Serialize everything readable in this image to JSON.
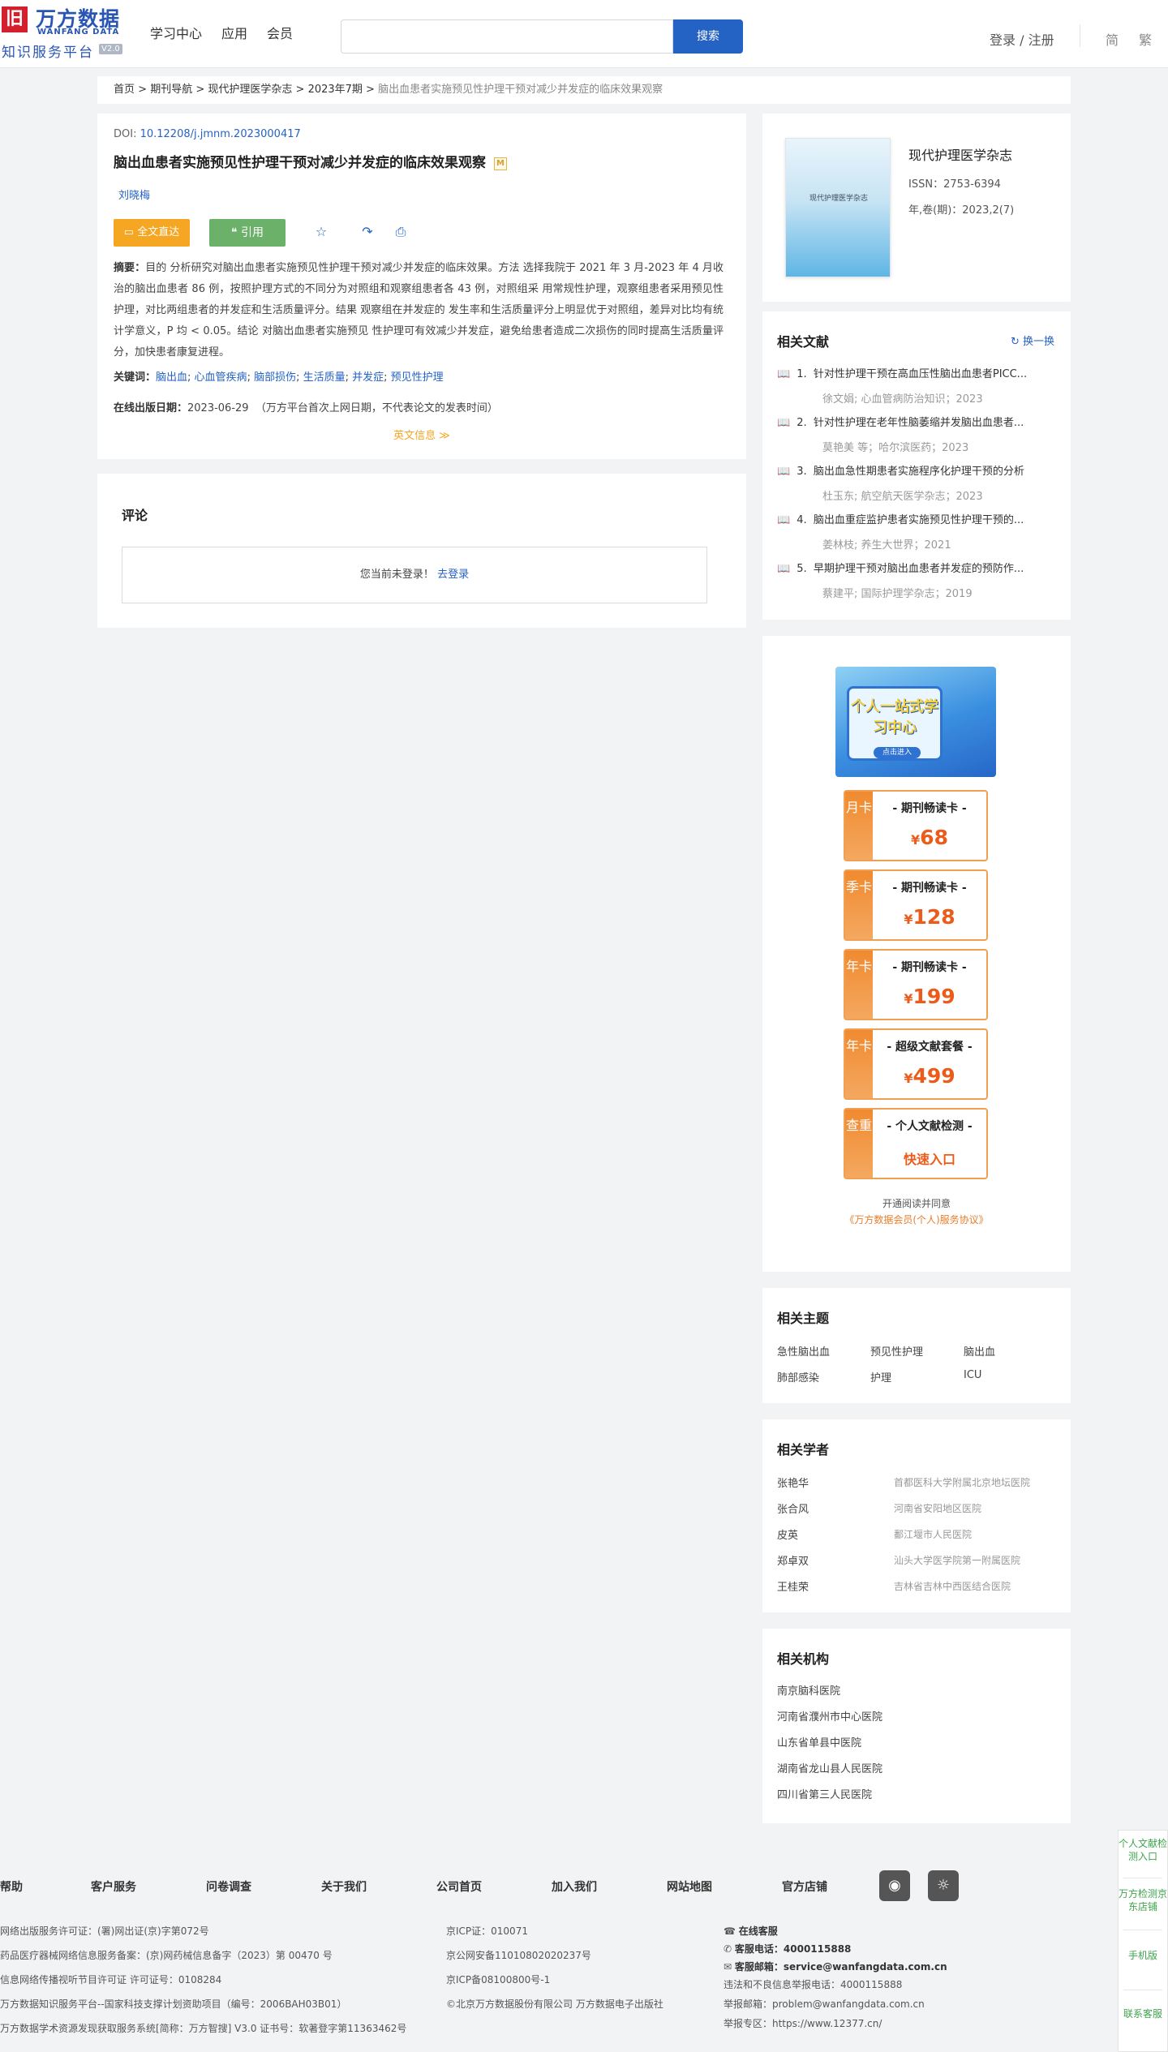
{
  "header": {
    "logo_mark": "旧",
    "logo_cn": "万方数据",
    "logo_en": "WANFANG DATA",
    "logo_sub": "知识服务平台",
    "version": "V2.0",
    "nav": [
      "学习中心",
      "应用",
      "会员"
    ],
    "search_placeholder": "",
    "search_button": "搜索",
    "login": "登录 / 注册",
    "lang_simplified": "简",
    "lang_traditional": "繁"
  },
  "breadcrumb": {
    "items": [
      "首页",
      "期刊导航",
      "现代护理医学杂志",
      "2023年7期"
    ],
    "current": "脑出血患者实施预见性护理干预对减少并发症的临床效果观察",
    "sep": " > "
  },
  "article": {
    "doi_label": "DOI: ",
    "doi": "10.12208/j.jmnm.2023000417",
    "title": "脑出血患者实施预见性护理干预对减少并发症的临床效果观察",
    "title_badge": "M",
    "author": "刘晓梅",
    "btn_fulltext": "全文直达",
    "btn_cite": "引用",
    "abstract_label": "摘要：",
    "abstract": "目的 分析研究对脑出血患者实施预见性护理干预对减少并发症的临床效果。方法 选择我院于 2021 年 3 月-2023 年 4 月收治的脑出血患者 86 例，按照护理方式的不同分为对照组和观察组患者各 43 例，对照组采 用常规性护理，观察组患者采用预见性护理，对比两组患者的并发症和生活质量评分。结果 观察组在并发症的 发生率和生活质量评分上明显优于对照组，差异对比均有统计学意义，P 均 < 0.05。结论 对脑出血患者实施预见 性护理可有效减少并发症，避免给患者造成二次损伤的同时提高生活质量评分，加快患者康复进程。",
    "keywords_label": "关键词：",
    "keywords": [
      "脑出血",
      "心血管疾病",
      "脑部损伤",
      "生活质量",
      "并发症",
      "预见性护理"
    ],
    "pub_label": "在线出版日期：",
    "pub_date": "2023-06-29",
    "pub_note": "（万方平台首次上网日期，不代表论文的发表时间）",
    "en_info": "英文信息 ≫"
  },
  "comment": {
    "title": "评论",
    "notice": "您当前未登录！",
    "login_link": "去登录"
  },
  "journal": {
    "cover_text": "现代护理医学杂志",
    "name": "现代护理医学杂志",
    "issn": "ISSN：2753-6394",
    "year": "年,卷(期)：2023,2(7)"
  },
  "related": {
    "title": "相关文献",
    "swap": "换一换",
    "items": [
      {
        "n": "1.",
        "t": "针对性护理干预在高血压性脑出血患者PICC...",
        "m": "徐文娟; 心血管病防治知识；2023"
      },
      {
        "n": "2.",
        "t": "针对性护理在老年性脑萎缩并发脑出血患者...",
        "m": "莫艳美  等；哈尔滨医药；2023"
      },
      {
        "n": "3.",
        "t": "脑出血急性期患者实施程序化护理干预的分析",
        "m": "杜玉东; 航空航天医学杂志；2023"
      },
      {
        "n": "4.",
        "t": "脑出血重症监护患者实施预见性护理干预的...",
        "m": "姜林枝; 养生大世界；2021"
      },
      {
        "n": "5.",
        "t": "早期护理干预对脑出血患者并发症的预防作...",
        "m": "蔡建平; 国际护理学杂志；2019"
      }
    ]
  },
  "ads": {
    "banner_title": "个人一站式学习中心",
    "banner_btn": "点击进入",
    "plans": [
      {
        "side": "月卡",
        "name": "- 期刊畅读卡 -",
        "price": "68",
        "currency": "¥"
      },
      {
        "side": "季卡",
        "name": "- 期刊畅读卡 -",
        "price": "128",
        "currency": "¥"
      },
      {
        "side": "年卡",
        "name": "- 期刊畅读卡 -",
        "price": "199",
        "currency": "¥"
      },
      {
        "side": "年卡",
        "name": "- 超级文献套餐 -",
        "price": "499",
        "currency": "¥"
      },
      {
        "side": "查重",
        "name": "- 个人文献检测 -",
        "price": "快速入口",
        "currency": ""
      }
    ],
    "agree_line1": "开通阅读并同意",
    "agree_line2": "《万方数据会员(个人)服务协议》"
  },
  "topics": {
    "title": "相关主题",
    "items": [
      "急性脑出血",
      "预见性护理",
      "脑出血",
      "肺部感染",
      "护理",
      "ICU"
    ]
  },
  "scholars": {
    "title": "相关学者",
    "items": [
      {
        "name": "张艳华",
        "org": "首都医科大学附属北京地坛医院"
      },
      {
        "name": "张合风",
        "org": "河南省安阳地区医院"
      },
      {
        "name": "皮英",
        "org": "鄱江堰市人民医院"
      },
      {
        "name": "郑卓双",
        "org": "汕头大学医学院第一附属医院"
      },
      {
        "name": "王桂荣",
        "org": "吉林省吉林中西医结合医院"
      }
    ]
  },
  "institutions": {
    "title": "相关机构",
    "items": [
      "南京脑科医院",
      "河南省濮州市中心医院",
      "山东省单县中医院",
      "湖南省龙山县人民医院",
      "四川省第三人民医院"
    ]
  },
  "footer": {
    "nav": [
      "帮助",
      "客户服务",
      "问卷调查",
      "关于我们",
      "公司首页",
      "加入我们",
      "网站地图",
      "官方店铺"
    ],
    "col1": [
      "网络出版服务许可证：(署)网出证(京)字第072号",
      "药品医疗器械网络信息服务备案：(京)网药械信息备字（2023）第 00470 号",
      "信息网络传播视听节目许可证 许可证号：0108284",
      "万方数据知识服务平台--国家科技支撑计划资助项目（编号：2006BAH03B01）",
      "万方数据学术资源发现获取服务系统[简称：万方智搜] V3.0 证书号：软著登字第11363462号"
    ],
    "col2": [
      "京ICP证：010071",
      "京公网安备11010802020237号",
      "京ICP备08100800号-1",
      "©北京万方数据股份有限公司 万方数据电子出版社"
    ],
    "col3_online": "在线客服",
    "col3_phone_label": "客服电话：",
    "col3_phone": "4000115888",
    "col3_email_label": "客服邮箱：",
    "col3_email": "service@wanfangdata.com.cn",
    "col3_report_phone": "违法和不良信息举报电话：4000115888",
    "col3_report_email": "举报邮箱：problem@wanfangdata.com.cn",
    "col3_report_site": "举报专区：https://www.12377.cn/"
  },
  "float": {
    "items": [
      "个人文献检测入口",
      "万方检测京东店铺",
      "手机版",
      "联系客服"
    ]
  },
  "colors": {
    "brand_blue": "#2462c3",
    "orange": "#f5a623",
    "green": "#6cb16a",
    "price_red": "#ec5b1a"
  }
}
